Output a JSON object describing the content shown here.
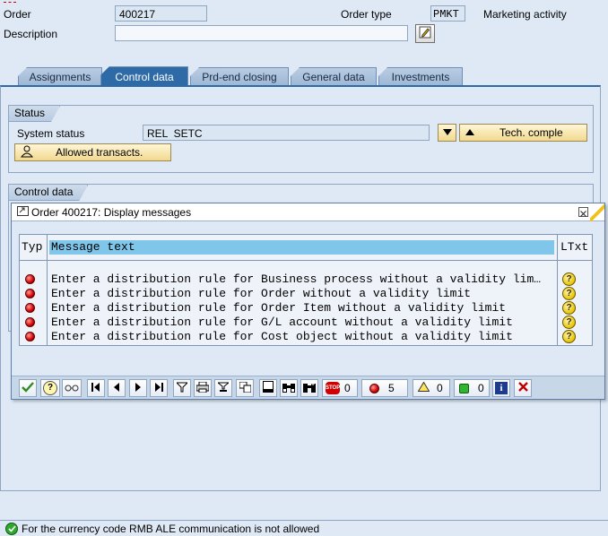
{
  "header": {
    "order_label": "Order",
    "order_value": "400217",
    "order_type_label": "Order type",
    "order_type_value": "PMKT",
    "order_type_desc": "Marketing activity",
    "description_label": "Description",
    "description_value": ""
  },
  "tabs": [
    {
      "label": "Assignments"
    },
    {
      "label": "Control data"
    },
    {
      "label": "Prd-end closing"
    },
    {
      "label": "General data"
    },
    {
      "label": "Investments"
    }
  ],
  "status_group": {
    "title": "Status",
    "system_status_label": "System status",
    "system_status_value": "REL  SETC",
    "tech_complete_button": "Tech. comple",
    "allowed_transacts_button": "Allowed transacts."
  },
  "control_group": {
    "title": "Control data"
  },
  "dialog": {
    "title": "Order 400217: Display messages",
    "columns": {
      "typ": "Typ",
      "message": "Message text",
      "ltxt": "LTxt"
    },
    "messages": [
      {
        "text": "Enter a distribution rule for Business process without a validity lim…"
      },
      {
        "text": "Enter a distribution rule for Order without a validity limit"
      },
      {
        "text": "Enter a distribution rule for Order Item without a validity limit"
      },
      {
        "text": "Enter a distribution rule for G/L account without a validity limit"
      },
      {
        "text": "Enter a distribution rule for Cost object without a validity limit"
      }
    ],
    "counts": {
      "stop": "0",
      "error": "5",
      "warning": "0",
      "info": "0"
    }
  },
  "statusbar": {
    "message": "For the currency code RMB ALE communication is not allowed"
  },
  "colors": {
    "active_tab": "#2e6aa6",
    "error_led": "#d00000",
    "background": "#dfe9f5"
  }
}
